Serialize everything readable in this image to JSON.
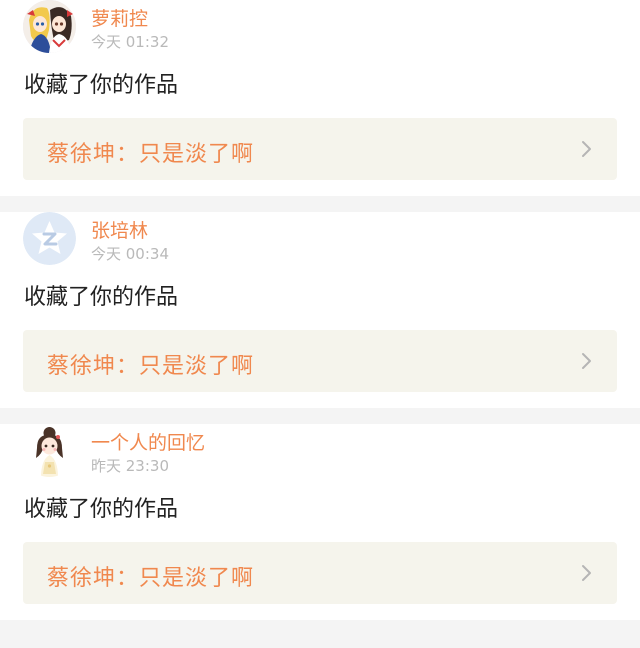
{
  "notifications": [
    {
      "avatar_icon": "anime-girls-avatar-icon",
      "username": "萝莉控",
      "time": "今天 01:32",
      "action": "收藏了你的作品",
      "work_title": "蔡徐坤：只是淡了啊",
      "chevron_icon": "chevron-right-icon"
    },
    {
      "avatar_icon": "default-qzone-star-avatar-icon",
      "username": "张培林",
      "time": "今天 00:34",
      "action": "收藏了你的作品",
      "work_title": "蔡徐坤：只是淡了啊",
      "chevron_icon": "chevron-right-icon"
    },
    {
      "avatar_icon": "chibi-girl-avatar-icon",
      "username": "一个人的回忆",
      "time": "昨天 23:30",
      "action": "收藏了你的作品",
      "work_title": "蔡徐坤：只是淡了啊",
      "chevron_icon": "chevron-right-icon"
    }
  ],
  "colors": {
    "accent": "#f0884e",
    "card_link_bg": "#f5f4ec",
    "page_bg": "#f4f4f4",
    "timestamp": "#b9b9b9"
  }
}
